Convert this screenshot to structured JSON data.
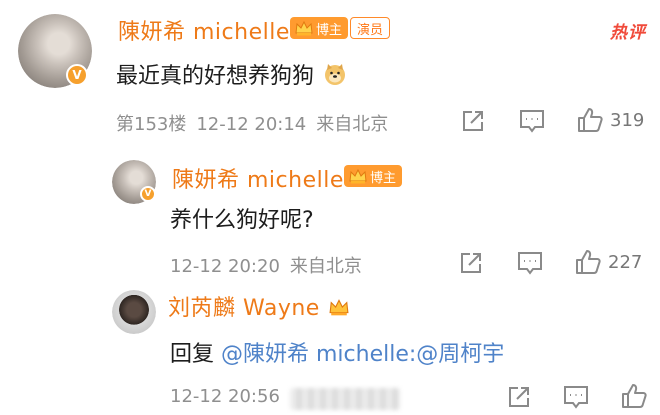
{
  "hot_label": "热评",
  "comments": [
    {
      "author": "陳妍希 michelle",
      "badge_host": "博主",
      "badge_actor": "演员",
      "text": "最近真的好想养狗狗",
      "emoji": "doge-emoji",
      "floor": "第153楼",
      "time": "12-12 20:14",
      "location": "来自北京",
      "likes": "319",
      "verified": "V"
    },
    {
      "author": "陳妍希 michelle",
      "badge_host": "博主",
      "text": "养什么狗好呢?",
      "time": "12-12 20:20",
      "location": "来自北京",
      "likes": "227",
      "verified": "V"
    },
    {
      "author": "刘芮麟 Wayne",
      "text_prefix": "回复 ",
      "mention1": "@陳妍希 michelle",
      "colon": ":",
      "mention2": "@周柯宇",
      "time": "12-12 20:56",
      "likes": ""
    }
  ],
  "icons": {
    "share": "share-icon",
    "comment": "comment-icon",
    "like": "thumbs-up-icon",
    "crown": "crown-icon"
  },
  "colors": {
    "name": "#ee7a18",
    "mention": "#4f83c9",
    "hot": "#f04a3a",
    "badge": "#ff9b2f",
    "meta": "#8f8f8f"
  }
}
